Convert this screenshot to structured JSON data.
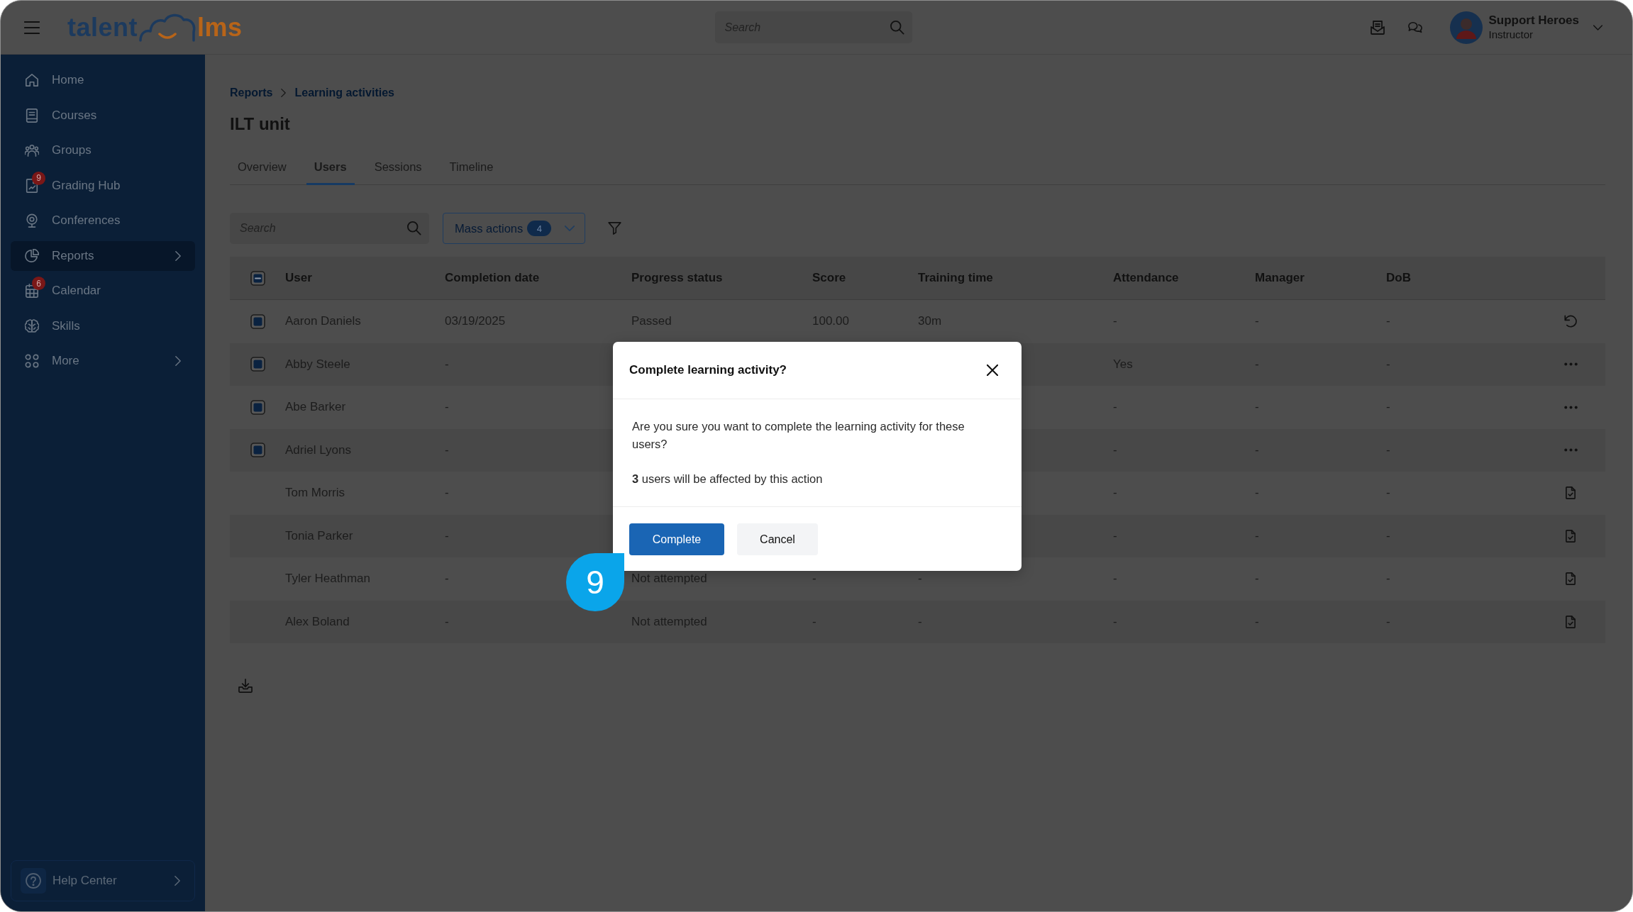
{
  "header": {
    "logo": {
      "wordmark_start": "talent",
      "wordmark_end": "lms"
    },
    "search": {
      "placeholder": "Search"
    },
    "user": {
      "name": "Support Heroes",
      "role": "Instructor"
    }
  },
  "sidebar": {
    "items": [
      {
        "label": "Home",
        "selected": false,
        "expandable": false
      },
      {
        "label": "Courses",
        "selected": false,
        "expandable": false
      },
      {
        "label": "Groups",
        "selected": false,
        "expandable": false
      },
      {
        "label": "Grading Hub",
        "badge": "9",
        "selected": false,
        "expandable": false
      },
      {
        "label": "Conferences",
        "selected": false,
        "expandable": false
      },
      {
        "label": "Reports",
        "selected": true,
        "expandable": true
      },
      {
        "label": "Calendar",
        "badge": "6",
        "selected": false,
        "expandable": false
      },
      {
        "label": "Skills",
        "selected": false,
        "expandable": false
      },
      {
        "label": "More",
        "selected": false,
        "expandable": true
      }
    ],
    "help": {
      "label": "Help Center",
      "expandable": true
    }
  },
  "page": {
    "breadcrumb": [
      "Reports",
      "Learning activities"
    ],
    "title": "ILT unit",
    "tabs": [
      {
        "label": "Overview",
        "selected": false
      },
      {
        "label": "Users",
        "selected": true
      },
      {
        "label": "Sessions",
        "selected": false
      },
      {
        "label": "Timeline",
        "selected": false
      }
    ]
  },
  "toolbar": {
    "search": {
      "placeholder": "Search"
    },
    "mass_actions": {
      "label": "Mass actions",
      "count": "4"
    }
  },
  "table": {
    "select_all": {
      "indeterminate": true
    },
    "columns": [
      "User",
      "Completion date",
      "Progress status",
      "Score",
      "Training time",
      "Attendance",
      "Manager",
      "DoB"
    ],
    "rows": [
      {
        "user": "Aaron Daniels",
        "checked": true,
        "kind": "reset",
        "completion_date": "03/19/2025",
        "progress_status": "Passed",
        "score": "100.00",
        "training_time": "30m",
        "attendance": "-",
        "manager": "-",
        "dob": "-"
      },
      {
        "user": "Abby Steele",
        "checked": true,
        "kind": "menu",
        "completion_date": "-",
        "attendance": "Yes",
        "manager": "-",
        "dob": "-"
      },
      {
        "user": "Abe Barker",
        "checked": true,
        "kind": "menu",
        "completion_date": "-",
        "attendance": "-",
        "manager": "-",
        "dob": "-"
      },
      {
        "user": "Adriel Lyons",
        "checked": true,
        "kind": "menu",
        "completion_date": "-",
        "attendance": "-",
        "manager": "-",
        "dob": "-"
      },
      {
        "user": "Tom Morris",
        "checked": false,
        "kind": "file",
        "completion_date": "-",
        "attendance": "-",
        "manager": "-",
        "dob": "-"
      },
      {
        "user": "Tonia Parker",
        "checked": false,
        "kind": "file",
        "completion_date": "-",
        "attendance": "-",
        "manager": "-",
        "dob": "-"
      },
      {
        "user": "Tyler Heathman",
        "checked": false,
        "kind": "file",
        "completion_date": "-",
        "progress_status": "Not attempted",
        "score": "-",
        "training_time": "-",
        "attendance": "-",
        "manager": "-",
        "dob": "-"
      },
      {
        "user": "Alex Boland",
        "checked": false,
        "kind": "file",
        "completion_date": "-",
        "progress_status": "Not attempted",
        "score": "-",
        "training_time": "-",
        "attendance": "-",
        "manager": "-",
        "dob": "-"
      }
    ]
  },
  "dialog": {
    "title": "Complete learning activity?",
    "message": "Are you sure you want to complete the learning activity for these users?",
    "note": "**3** users will be affected by this action",
    "buttons": [
      {
        "label": "Complete",
        "kind": "primary"
      },
      {
        "label": "Cancel",
        "kind": "secondary"
      }
    ]
  },
  "callout": {
    "label": "9"
  }
}
